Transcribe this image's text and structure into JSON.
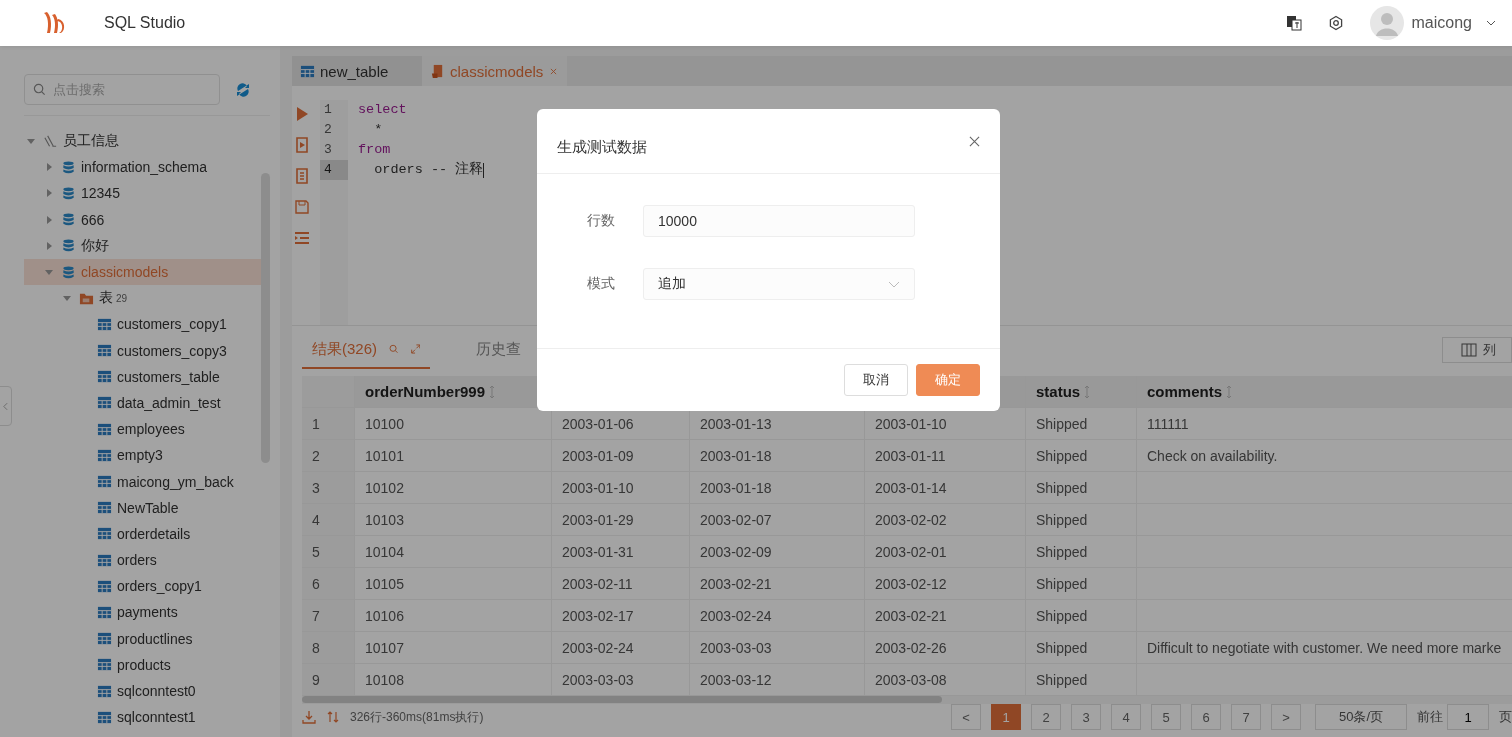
{
  "header": {
    "title": "SQL Studio",
    "user": "maicong"
  },
  "sidebar": {
    "search": {
      "placeholder": "点击搜索"
    },
    "tree": [
      {
        "label": "员工信息",
        "kind": "connection",
        "expanded": true,
        "selected": false,
        "children": [
          {
            "label": "information_schema",
            "kind": "database",
            "expanded": false,
            "selected": false
          },
          {
            "label": "12345",
            "kind": "database",
            "expanded": false,
            "selected": false
          },
          {
            "label": "666",
            "kind": "database",
            "expanded": false,
            "selected": false
          },
          {
            "label": "你好",
            "kind": "database",
            "expanded": false,
            "selected": false
          },
          {
            "label": "classicmodels",
            "kind": "database",
            "expanded": true,
            "selected": true,
            "children": [
              {
                "label": "表",
                "badge": "29",
                "kind": "folder",
                "expanded": true,
                "selected": false,
                "children": [
                  {
                    "label": "customers_copy1",
                    "kind": "table",
                    "selected": false
                  },
                  {
                    "label": "customers_copy3",
                    "kind": "table",
                    "selected": false
                  },
                  {
                    "label": "customers_table",
                    "kind": "table",
                    "selected": false
                  },
                  {
                    "label": "data_admin_test",
                    "kind": "table",
                    "selected": false
                  },
                  {
                    "label": "employees",
                    "kind": "table",
                    "selected": false
                  },
                  {
                    "label": "empty3",
                    "kind": "table",
                    "selected": false
                  },
                  {
                    "label": "maicong_ym_back",
                    "kind": "table",
                    "selected": false
                  },
                  {
                    "label": "NewTable",
                    "kind": "table",
                    "selected": false
                  },
                  {
                    "label": "orderdetails",
                    "kind": "table",
                    "selected": false
                  },
                  {
                    "label": "orders",
                    "kind": "table",
                    "selected": false
                  },
                  {
                    "label": "orders_copy1",
                    "kind": "table",
                    "selected": false
                  },
                  {
                    "label": "payments",
                    "kind": "table",
                    "selected": false
                  },
                  {
                    "label": "productlines",
                    "kind": "table",
                    "selected": false
                  },
                  {
                    "label": "products",
                    "kind": "table",
                    "selected": false
                  },
                  {
                    "label": "sqlconntest0",
                    "kind": "table",
                    "selected": false
                  },
                  {
                    "label": "sqlconntest1",
                    "kind": "table",
                    "selected": false
                  }
                ]
              }
            ]
          }
        ]
      }
    ]
  },
  "editor_tabs": [
    {
      "label": "new_table",
      "kind": "table",
      "selected": false,
      "closable": false
    },
    {
      "label": "classicmodels",
      "kind": "query",
      "selected": true,
      "closable": true
    }
  ],
  "code_lines": [
    {
      "number": "1",
      "current": false,
      "tokens": [
        {
          "text": "select",
          "kind": "keyword"
        }
      ]
    },
    {
      "number": "2",
      "current": false,
      "tokens": [
        {
          "text": "  *",
          "kind": "plain"
        }
      ]
    },
    {
      "number": "3",
      "current": false,
      "tokens": [
        {
          "text": "from",
          "kind": "keyword"
        }
      ]
    },
    {
      "number": "4",
      "current": true,
      "tokens": [
        {
          "text": "  orders -- 注释",
          "kind": "plain"
        }
      ]
    }
  ],
  "result_tabs": [
    {
      "label": "结果(326)",
      "selected": true
    },
    {
      "label": "历史查",
      "selected": false
    }
  ],
  "columns_button": "列",
  "table": {
    "columns": [
      {
        "label": "orderNumber999"
      },
      {},
      {},
      {},
      {
        "label": "status"
      },
      {
        "label": "comments"
      }
    ],
    "rows": [
      {
        "index": "1",
        "cells": [
          "10100",
          "2003-01-06",
          "2003-01-13",
          "2003-01-10",
          "Shipped",
          "111111"
        ]
      },
      {
        "index": "2",
        "cells": [
          "10101",
          "2003-01-09",
          "2003-01-18",
          "2003-01-11",
          "Shipped",
          "Check on availability."
        ]
      },
      {
        "index": "3",
        "cells": [
          "10102",
          "2003-01-10",
          "2003-01-18",
          "2003-01-14",
          "Shipped"
        ]
      },
      {
        "index": "4",
        "cells": [
          "10103",
          "2003-01-29",
          "2003-02-07",
          "2003-02-02",
          "Shipped"
        ]
      },
      {
        "index": "5",
        "cells": [
          "10104",
          "2003-01-31",
          "2003-02-09",
          "2003-02-01",
          "Shipped"
        ]
      },
      {
        "index": "6",
        "cells": [
          "10105",
          "2003-02-11",
          "2003-02-21",
          "2003-02-12",
          "Shipped"
        ]
      },
      {
        "index": "7",
        "cells": [
          "10106",
          "2003-02-17",
          "2003-02-24",
          "2003-02-21",
          "Shipped"
        ]
      },
      {
        "index": "8",
        "cells": [
          "10107",
          "2003-02-24",
          "2003-03-03",
          "2003-02-26",
          "Shipped",
          "Difficult to negotiate with customer. We need more marke"
        ]
      },
      {
        "index": "9",
        "cells": [
          "10108",
          "2003-03-03",
          "2003-03-12",
          "2003-03-08",
          "Shipped"
        ]
      }
    ]
  },
  "status": "326行-360ms(81ms执行)",
  "pagination": {
    "prev": "<",
    "pages": [
      {
        "label": "1",
        "selected": true
      },
      {
        "label": "2",
        "selected": false
      },
      {
        "label": "3",
        "selected": false
      },
      {
        "label": "4",
        "selected": false
      },
      {
        "label": "5",
        "selected": false
      },
      {
        "label": "6",
        "selected": false
      },
      {
        "label": "7",
        "selected": false
      }
    ],
    "next": ">",
    "page_size": "50条/页",
    "goto_label": "前往",
    "goto_value": "1",
    "goto_suffix": "页"
  },
  "dialog": {
    "title": "生成测试数据",
    "fields": [
      {
        "label": "行数",
        "kind": "input",
        "value": "10000"
      },
      {
        "label": "模式",
        "kind": "select",
        "value": "追加"
      }
    ],
    "cancel": "取消",
    "confirm": "确定"
  }
}
